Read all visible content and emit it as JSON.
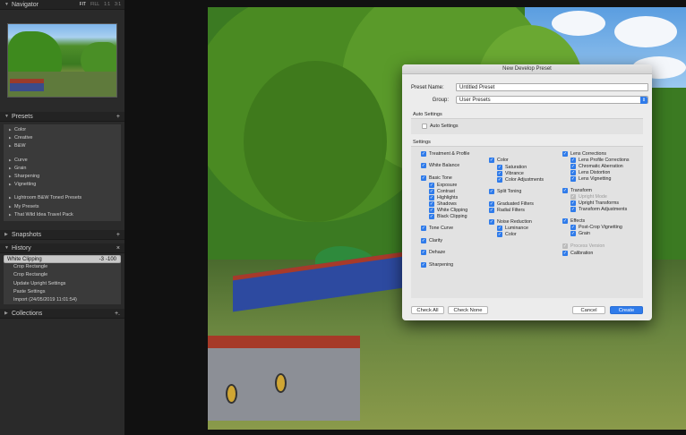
{
  "navigator": {
    "title": "Navigator",
    "zoom": [
      "FIT",
      "FILL",
      "1:1",
      "3:1"
    ]
  },
  "presets": {
    "title": "Presets",
    "add": "+",
    "group1": [
      "Color",
      "Creative",
      "B&W"
    ],
    "group2": [
      "Curve",
      "Grain",
      "Sharpening",
      "Vignetting"
    ],
    "group3": [
      "Lightroom B&W Toned Presets",
      "My Presets",
      "That Wild Idea Travel Pack"
    ]
  },
  "snapshots": {
    "title": "Snapshots",
    "add": "+"
  },
  "history": {
    "title": "History",
    "close": "×",
    "items": [
      {
        "label": "White Clipping",
        "v1": "-3",
        "v2": "-100"
      },
      {
        "label": "Crop Rectangle"
      },
      {
        "label": "Crop Rectangle"
      },
      {
        "label": "Update Upright Settings"
      },
      {
        "label": "Paste Settings"
      },
      {
        "label": "Import (24/05/2019 11:01:54)"
      }
    ]
  },
  "collections": {
    "title": "Collections",
    "add": "+."
  },
  "dialog": {
    "title": "New Develop Preset",
    "preset_name_label": "Preset Name:",
    "preset_name_value": "Untitled Preset",
    "group_label": "Group:",
    "group_value": "User Presets",
    "auto_settings_title": "Auto Settings",
    "auto_settings_check": "Auto Settings",
    "settings_title": "Settings",
    "col1": {
      "treatment": "Treatment & Profile",
      "white_balance": "White Balance",
      "basic_tone": "Basic Tone",
      "basic_sub": [
        "Exposure",
        "Contrast",
        "Highlights",
        "Shadows",
        "White Clipping",
        "Black Clipping"
      ],
      "tone_curve": "Tone Curve",
      "clarity": "Clarity",
      "dehaze": "Dehaze",
      "sharpening": "Sharpening"
    },
    "col2": {
      "color": "Color",
      "color_sub": [
        "Saturation",
        "Vibrance",
        "Color Adjustments"
      ],
      "split_toning": "Split Toning",
      "graduated_filters": "Graduated Filters",
      "radial_filters": "Radial Filters",
      "noise_reduction": "Noise Reduction",
      "noise_sub": [
        "Luminance",
        "Color"
      ]
    },
    "col3": {
      "lens_corrections": "Lens Corrections",
      "lens_sub": [
        "Lens Profile Corrections",
        "Chromatic Aberration",
        "Lens Distortion",
        "Lens Vignetting"
      ],
      "transform": "Transform",
      "transform_sub": [
        "Upright Mode",
        "Upright Transforms",
        "Transform Adjustments"
      ],
      "effects": "Effects",
      "effects_sub": [
        "Post-Crop Vignetting",
        "Grain"
      ],
      "process_version": "Process Version",
      "calibration": "Calibration"
    },
    "buttons": {
      "check_all": "Check All",
      "check_none": "Check None",
      "cancel": "Cancel",
      "create": "Create"
    }
  },
  "colors": {
    "accent": "#2f7bea",
    "panel": "#2a2a2a",
    "dialog": "#ececec"
  }
}
